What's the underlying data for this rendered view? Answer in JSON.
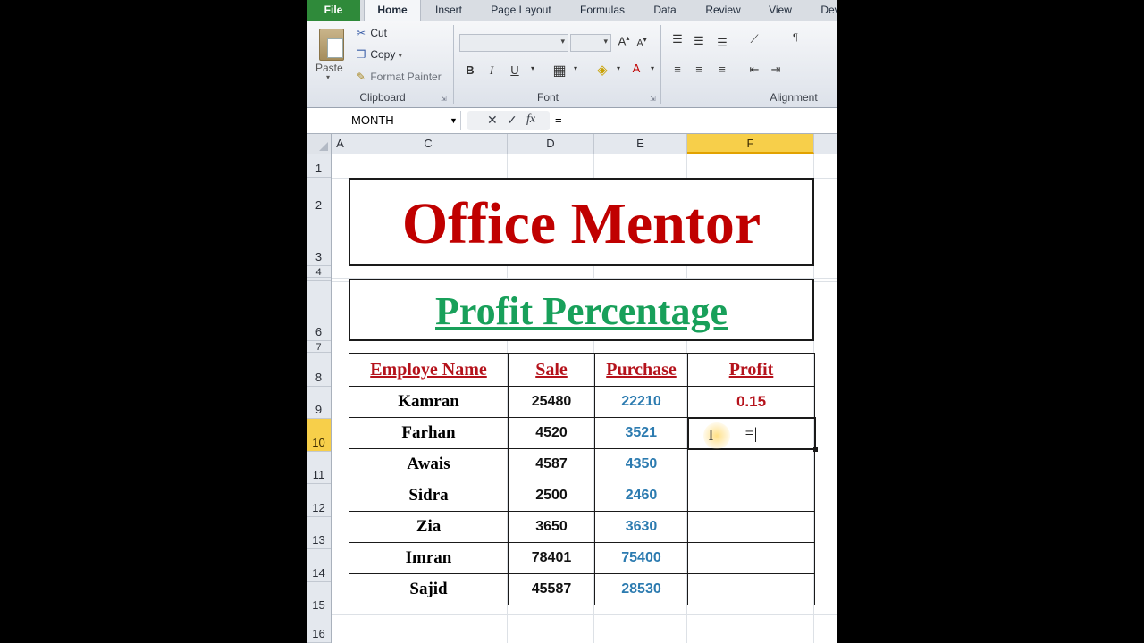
{
  "ribbon": {
    "tabs": [
      "File",
      "Home",
      "Insert",
      "Page Layout",
      "Formulas",
      "Data",
      "Review",
      "View",
      "Dev"
    ],
    "clipboard": {
      "paste": "Paste",
      "cut": "Cut",
      "copy": "Copy",
      "format_painter": "Format Painter",
      "label": "Clipboard"
    },
    "font": {
      "label": "Font",
      "bold": "B",
      "italic": "I",
      "underline": "U"
    },
    "alignment": {
      "label": "Alignment"
    }
  },
  "formula_bar": {
    "name_box": "MONTH",
    "cancel": "✕",
    "enter": "✓",
    "fx": "fx",
    "content": "="
  },
  "columns": [
    "A",
    "C",
    "D",
    "E",
    "F"
  ],
  "rows": [
    "1",
    "2",
    "3",
    "4",
    "",
    "6",
    "7",
    "8",
    "9",
    "10",
    "11",
    "12",
    "13",
    "14",
    "15",
    "16"
  ],
  "sheet": {
    "title": "Office Mentor",
    "subtitle": "Profit Percentage",
    "headers": [
      "Employe Name",
      "Sale",
      "Purchase",
      "Profit"
    ],
    "records": [
      {
        "name": "Kamran",
        "sale": "25480",
        "purchase": "22210",
        "profit": "0.15"
      },
      {
        "name": "Farhan",
        "sale": "4520",
        "purchase": "3521",
        "profit": "="
      },
      {
        "name": "Awais",
        "sale": "4587",
        "purchase": "4350",
        "profit": ""
      },
      {
        "name": "Sidra",
        "sale": "2500",
        "purchase": "2460",
        "profit": ""
      },
      {
        "name": "Zia",
        "sale": "3650",
        "purchase": "3630",
        "profit": ""
      },
      {
        "name": "Imran",
        "sale": "78401",
        "purchase": "75400",
        "profit": ""
      },
      {
        "name": "Sajid",
        "sale": "45587",
        "purchase": "28530",
        "profit": ""
      }
    ]
  },
  "colors": {
    "title": "#c00000",
    "subtitle": "#18a05a",
    "header_text": "#b5121b",
    "purchase_text": "#2c7bb0",
    "selection": "#f7cf4a"
  }
}
